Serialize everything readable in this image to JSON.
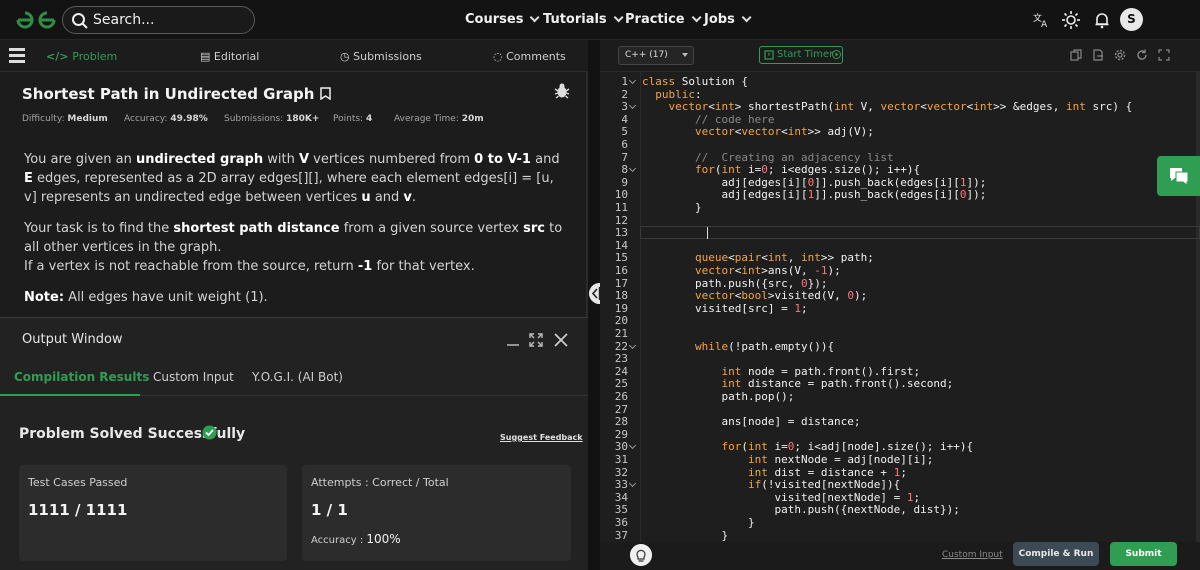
{
  "nav": {
    "logo_text": "GG",
    "search_placeholder": "Search...",
    "links": [
      "Courses",
      "Tutorials",
      "Practice",
      "Jobs"
    ],
    "icons": [
      "translate-icon",
      "sun-icon",
      "bell-icon"
    ],
    "avatar_initial": "S"
  },
  "left_tabs": {
    "problem": "Problem",
    "editorial": "Editorial",
    "submissions": "Submissions",
    "comments": "Comments"
  },
  "problem": {
    "title": "Shortest Path in Undirected Graph",
    "difficulty_label": "Difficulty:",
    "difficulty": "Medium",
    "accuracy_label": "Accuracy:",
    "accuracy": "49.98%",
    "submissions_label": "Submissions:",
    "submissions": "180K+",
    "points_label": "Points:",
    "points": "4",
    "avg_time_label": "Average Time:",
    "avg_time": "20m",
    "p1_a": "You are given an ",
    "p1_b": "undirected graph",
    "p1_c": " with ",
    "p1_d": "V",
    "p1_e": " vertices numbered from ",
    "p1_f": "0 to V-1",
    "p1_g": " and ",
    "p1_h": "E",
    "p1_i": " edges, represented as a 2D array edges[][], where each element edges[i] = [u, v] represents an undirected edge between vertices ",
    "p1_j": "u",
    "p1_k": " and ",
    "p1_l": "v",
    "p1_m": ".",
    "p2_a": "Your task is to find the ",
    "p2_b": "shortest path distance",
    "p2_c": " from a given source vertex ",
    "p2_d": "src",
    "p2_e": " to all other vertices in the graph.",
    "p2_f": "If a vertex is not reachable from the source, return ",
    "p2_g": "-1",
    "p2_h": " for that vertex.",
    "note_label": "Note:",
    "note_text": " All edges have unit weight (1)."
  },
  "output": {
    "title": "Output Window",
    "tabs": [
      "Compilation Results",
      "Custom Input",
      "Y.O.G.I. (AI Bot)"
    ],
    "status": "Problem Solved Successfully",
    "feedback_link": "Suggest Feedback",
    "card1_title": "Test Cases Passed",
    "card1_value": "1111 / 1111",
    "card2_title": "Attempts : Correct / Total",
    "card2_value": "1 / 1",
    "accuracy_label": "Accuracy :",
    "accuracy_value": "100%"
  },
  "editor": {
    "language": "C++ (17)",
    "timer_label": "Start Timer",
    "custom_input": "Custom Input",
    "compile_run": "Compile & Run",
    "submit": "Submit",
    "lines": [
      "class Solution {",
      "  public:",
      "    vector<int> shortestPath(int V, vector<vector<int>> &edges, int src) {",
      "        // code here",
      "        vector<vector<int>> adj(V);",
      "",
      "        //  Creating an adjacency list",
      "        for(int i=0; i<edges.size(); i++){",
      "            adj[edges[i][0]].push_back(edges[i][1]);",
      "            adj[edges[i][1]].push_back(edges[i][0]);",
      "        }",
      "",
      "",
      "",
      "        queue<pair<int, int>> path;",
      "        vector<int>ans(V, -1);",
      "        path.push({src, 0});",
      "        vector<bool>visited(V, 0);",
      "        visited[src] = 1;",
      "",
      "",
      "        while(!path.empty()){",
      "",
      "            int node = path.front().first;",
      "            int distance = path.front().second;",
      "            path.pop();",
      "",
      "            ans[node] = distance;",
      "",
      "            for(int i=0; i<adj[node].size(); i++){",
      "                int nextNode = adj[node][i];",
      "                int dist = distance + 1;",
      "                if(!visited[nextNode]){",
      "                    visited[nextNode] = 1;",
      "                    path.push({nextNode, dist});",
      "                }",
      "            }"
    ],
    "line_numbers": [
      "1",
      "2",
      "3",
      "4",
      "5",
      "6",
      "7",
      "8",
      "9",
      "10",
      "11",
      "12",
      "13",
      "14",
      "15",
      "16",
      "17",
      "18",
      "19",
      "20",
      "21",
      "22",
      "23",
      "24",
      "25",
      "26",
      "27",
      "28",
      "29",
      "30",
      "31",
      "32",
      "33",
      "34",
      "35",
      "36",
      "37"
    ],
    "fold_lines": [
      1,
      3,
      8,
      22,
      30,
      33
    ]
  }
}
